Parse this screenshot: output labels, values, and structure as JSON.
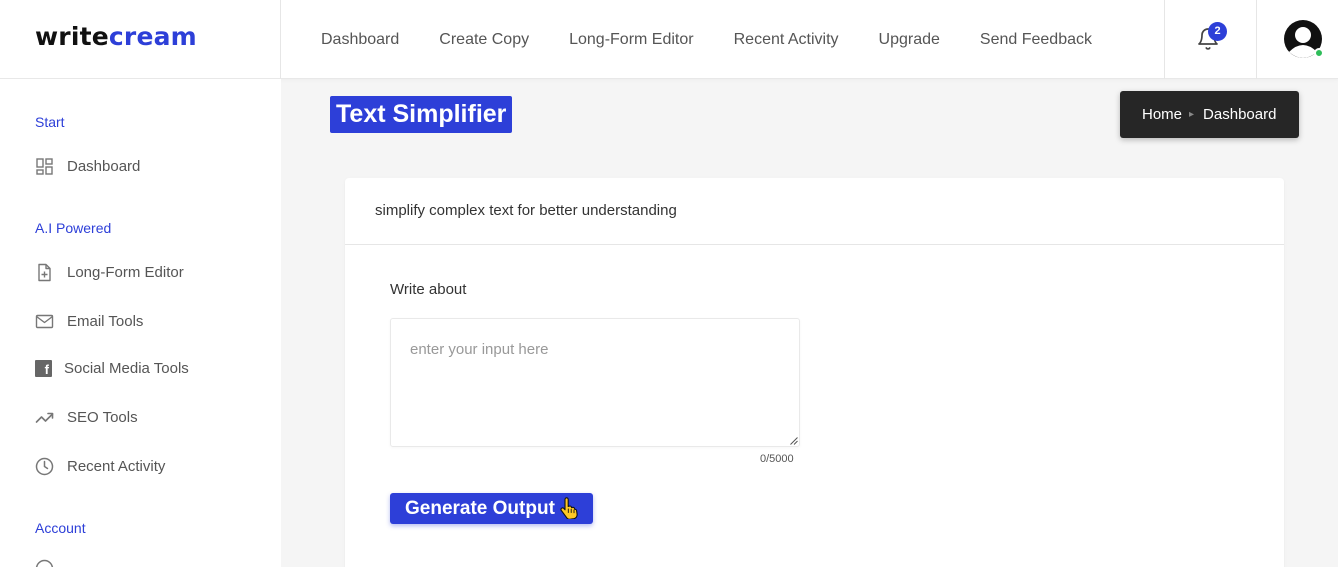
{
  "logo": {
    "part1": "write",
    "part2": "cream"
  },
  "nav": [
    "Dashboard",
    "Create Copy",
    "Long-Form Editor",
    "Recent Activity",
    "Upgrade",
    "Send Feedback"
  ],
  "notifications": {
    "count": "2",
    "icon": "bell-icon"
  },
  "user": {
    "icon": "user-avatar",
    "status_color": "#2ebd59"
  },
  "sidebar": {
    "sections": [
      {
        "title": "Start",
        "items": [
          {
            "label": "Dashboard",
            "icon": "dashboard-grid-icon"
          }
        ]
      },
      {
        "title": "A.I Powered",
        "items": [
          {
            "label": "Long-Form Editor",
            "icon": "document-plus-icon"
          },
          {
            "label": "Email Tools",
            "icon": "envelope-icon"
          },
          {
            "label": "Social Media Tools",
            "icon": "facebook-icon"
          },
          {
            "label": "SEO Tools",
            "icon": "trending-up-icon"
          },
          {
            "label": "Recent Activity",
            "icon": "clock-icon"
          }
        ]
      },
      {
        "title": "Account",
        "items": []
      }
    ]
  },
  "page": {
    "title": "Text Simplifier",
    "breadcrumb": [
      "Home",
      "Dashboard"
    ],
    "card_title": "simplify complex text for better understanding",
    "field_label": "Write about",
    "input_placeholder": "enter your input here",
    "counter": "0/5000",
    "button_label": "Generate Output"
  },
  "colors": {
    "accent": "#2d3fd8",
    "breadcrumb_bg": "#262626",
    "page_bg": "#f5f5f5"
  }
}
